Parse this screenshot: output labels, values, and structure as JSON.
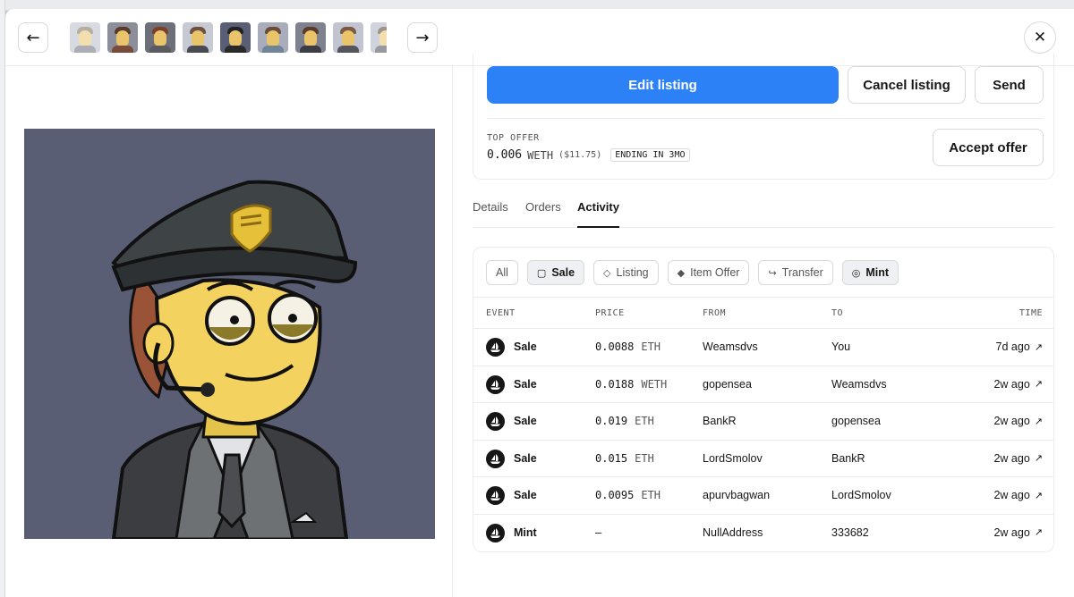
{
  "header": {
    "prev_icon": "arrow-left",
    "next_icon": "arrow-right",
    "close_icon": "close",
    "thumbnails": [
      {
        "hair": "#7a6a58",
        "bg": "#b9bcc8",
        "body": "#6b6b78"
      },
      {
        "hair": "#5b3a2e",
        "bg": "#8c8e99",
        "body": "#7a4a3a"
      },
      {
        "hair": "#7a3e2a",
        "bg": "#6d6f79",
        "body": "#5a5a60"
      },
      {
        "hair": "#6d5140",
        "bg": "#c8cad3",
        "body": "#4a4a52"
      },
      {
        "hair": "#222222",
        "bg": "#5a5e74",
        "body": "#2a2a2a"
      },
      {
        "hair": "#6b4b3a",
        "bg": "#a9adbb",
        "body": "#6f8496"
      },
      {
        "hair": "#5a3a2a",
        "bg": "#7e828f",
        "body": "#3c3c44"
      },
      {
        "hair": "#7a5a44",
        "bg": "#c2c5cf",
        "body": "#555560"
      },
      {
        "hair": "#4e3a2e",
        "bg": "#aab0bd",
        "body": "#444450"
      }
    ]
  },
  "actions": {
    "edit_label": "Edit listing",
    "cancel_label": "Cancel listing",
    "send_label": "Send",
    "accent": "#2d81f7"
  },
  "top_offer": {
    "label": "TOP OFFER",
    "amount": "0.006",
    "currency": "WETH",
    "usd": "($11.75)",
    "ending": "ENDING IN 3MO",
    "accept_label": "Accept offer"
  },
  "tabs": [
    {
      "label": "Details",
      "active": false
    },
    {
      "label": "Orders",
      "active": false
    },
    {
      "label": "Activity",
      "active": true
    }
  ],
  "filters": [
    {
      "label": "All",
      "icon": "",
      "active": false
    },
    {
      "label": "Sale",
      "icon": "bag-icon",
      "active": true
    },
    {
      "label": "Listing",
      "icon": "tag-icon",
      "active": false
    },
    {
      "label": "Item Offer",
      "icon": "offer-icon",
      "active": false
    },
    {
      "label": "Transfer",
      "icon": "transfer-icon",
      "active": false
    },
    {
      "label": "Mint",
      "icon": "mint-icon",
      "active": true
    }
  ],
  "table": {
    "headers": {
      "event": "EVENT",
      "price": "PRICE",
      "from": "FROM",
      "to": "TO",
      "time": "TIME"
    },
    "rows": [
      {
        "event": "Sale",
        "price": "0.0088",
        "currency": "ETH",
        "from": "Weamsdvs",
        "to": "You",
        "time": "7d ago"
      },
      {
        "event": "Sale",
        "price": "0.0188",
        "currency": "WETH",
        "from": "gopensea",
        "to": "Weamsdvs",
        "time": "2w ago"
      },
      {
        "event": "Sale",
        "price": "0.019",
        "currency": "ETH",
        "from": "BankR",
        "to": "gopensea",
        "time": "2w ago"
      },
      {
        "event": "Sale",
        "price": "0.015",
        "currency": "ETH",
        "from": "LordSmolov",
        "to": "BankR",
        "time": "2w ago"
      },
      {
        "event": "Sale",
        "price": "0.0095",
        "currency": "ETH",
        "from": "apurvbagwan",
        "to": "LordSmolov",
        "time": "2w ago"
      },
      {
        "event": "Mint",
        "price": "–",
        "currency": "",
        "from": "NullAddress",
        "to": "333682",
        "time": "2w ago"
      }
    ]
  }
}
